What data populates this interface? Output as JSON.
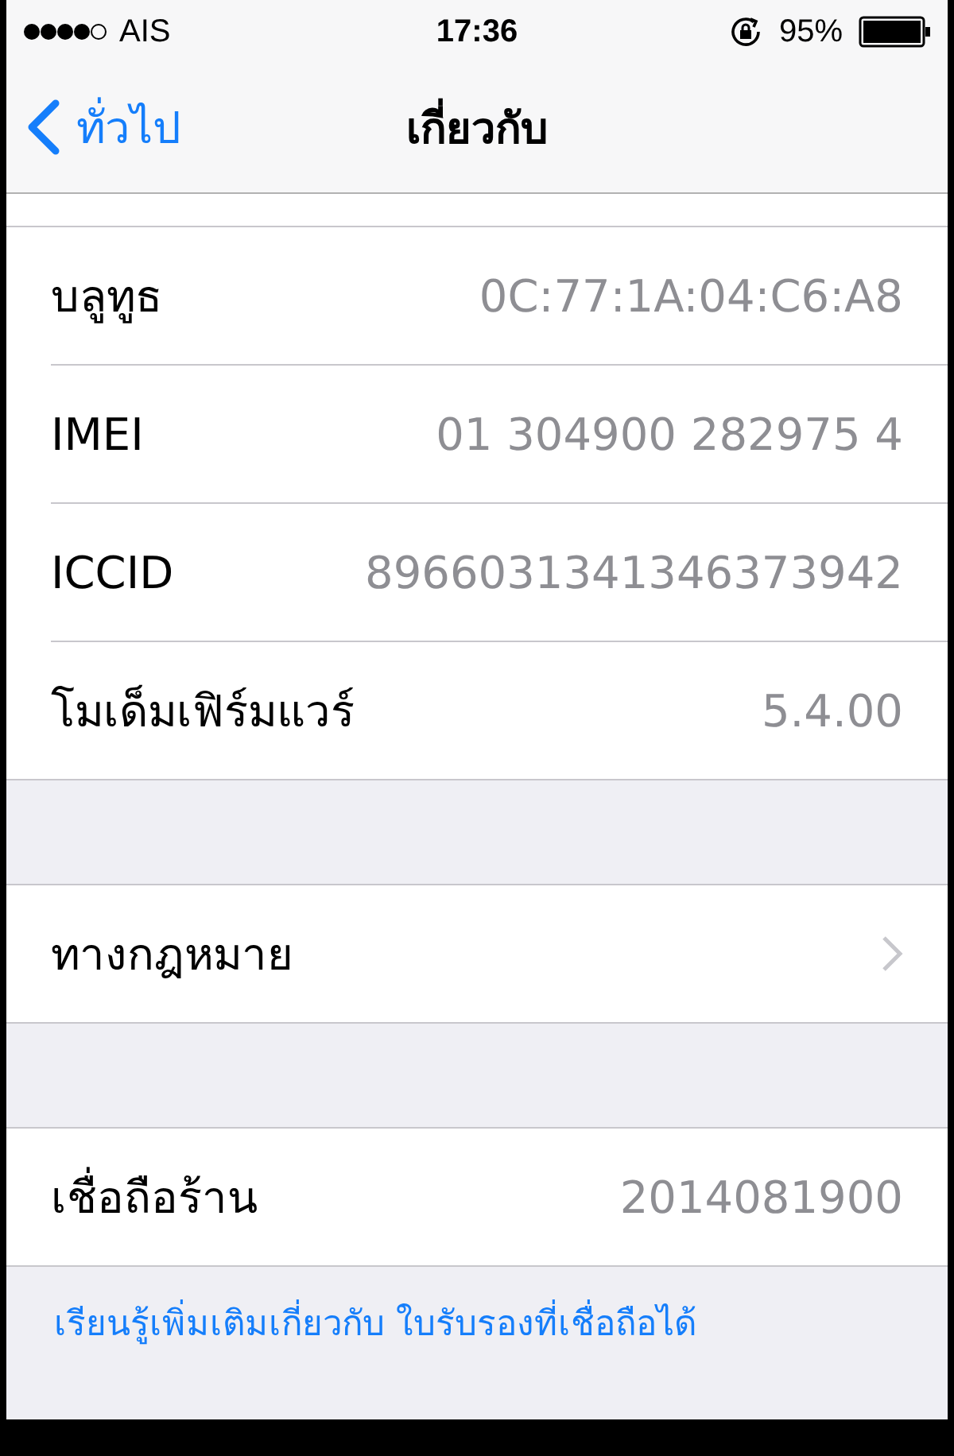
{
  "status_bar": {
    "carrier": "AIS",
    "time": "17:36",
    "battery": "95%"
  },
  "nav": {
    "back": "ทั่วไป",
    "title": "เกี่ยวกับ"
  },
  "sections": [
    {
      "rows": [
        {
          "kind": "value",
          "label": "บลูทูธ",
          "value": "0C:77:1A:04:C6:A8"
        },
        {
          "kind": "value",
          "label": "IMEI",
          "value": "01 304900 282975 4"
        },
        {
          "kind": "value",
          "label": "ICCID",
          "value": "8966031341346373942"
        },
        {
          "kind": "value",
          "label": "โมเด็มเฟิร์มแวร์",
          "value": "5.4.00"
        }
      ]
    },
    {
      "rows": [
        {
          "kind": "link",
          "label": "ทางกฎหมาย"
        }
      ]
    },
    {
      "rows": [
        {
          "kind": "value",
          "label": "เชื่อถือร้าน",
          "value": "2014081900"
        }
      ]
    }
  ],
  "footer_link": "เรียนรู้เพิ่มเติมเกี่ยวกับ ใบรับรองที่เชื่อถือได้"
}
